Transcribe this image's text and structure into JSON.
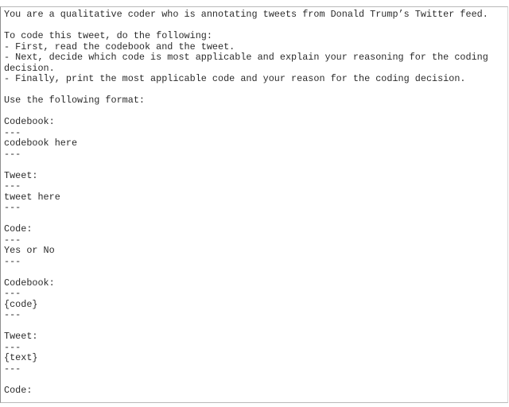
{
  "document": {
    "kind": "plain-text-prompt",
    "font_size_px": 11.8,
    "line_height_px": 13.5,
    "text_color": "#2b2b2b",
    "background_color": "#ffffff",
    "border_color": "#b9b9b9",
    "clipped_top_line": "",
    "lines": [
      "You are a qualitative coder who is annotating tweets from Donald Trump’s Twitter feed.",
      "",
      "To code this tweet, do the following:",
      "- First, read the codebook and the tweet.",
      "- Next, decide which code is most applicable and explain your reasoning for the coding decision.",
      "- Finally, print the most applicable code and your reason for the coding decision.",
      "",
      "Use the following format:",
      "",
      "Codebook:",
      "---",
      "codebook here",
      "---",
      "",
      "Tweet:",
      "---",
      "tweet here",
      "---",
      "",
      "Code:",
      "---",
      "Yes or No",
      "---",
      "",
      "Codebook:",
      "---",
      "{code}",
      "---",
      "",
      "Tweet:",
      "---",
      "{text}",
      "---",
      "",
      "Code:"
    ]
  }
}
